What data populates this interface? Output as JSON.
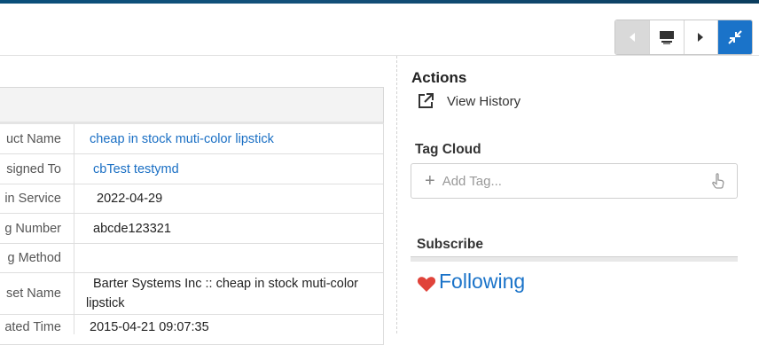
{
  "toolbar": {
    "buttons": [
      {
        "name": "previous",
        "icon": "chevron-left-icon",
        "state": "disabled"
      },
      {
        "name": "display",
        "icon": "monitor-icon",
        "state": "normal"
      },
      {
        "name": "next",
        "icon": "chevron-right-icon",
        "state": "normal"
      },
      {
        "name": "collapse",
        "icon": "collapse-arrows-icon",
        "state": "active"
      }
    ]
  },
  "details": {
    "rows": [
      {
        "label": "uct Name",
        "value": "cheap in stock muti-color lipstick",
        "link": true
      },
      {
        "label": "signed To",
        "value": "cbTest testymd",
        "link": true
      },
      {
        "label": "in Service",
        "value": "2022-04-29",
        "link": false
      },
      {
        "label": "g Number",
        "value": "abcde123321",
        "link": false
      },
      {
        "label": "g Method",
        "value": "",
        "link": false
      },
      {
        "label": "set Name",
        "value": "Barter Systems Inc :: cheap in stock muti-color lipstick",
        "link": false
      },
      {
        "label": "ated Time",
        "value": "2015-04-21 09:07:35",
        "link": false
      }
    ]
  },
  "actions": {
    "title": "Actions",
    "view_history": "View History"
  },
  "tag_cloud": {
    "title": "Tag Cloud",
    "placeholder": "Add Tag..."
  },
  "subscribe": {
    "title": "Subscribe",
    "following": "Following"
  },
  "colors": {
    "accent": "#1a73c9",
    "link": "#1a6fc4",
    "heart": "#e0433a",
    "disabled_button": "#d9d9d9"
  }
}
